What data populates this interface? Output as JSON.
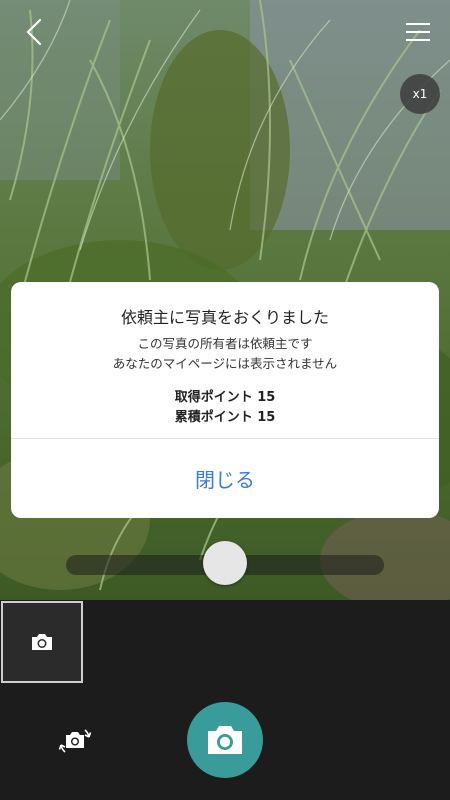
{
  "camera": {
    "zoom_label": "x1",
    "zoom_level": 0.0
  },
  "dialog": {
    "title": "依頼主に写真をおくりました",
    "message_line1": "この写真の所有者は依頼主です",
    "message_line2": "あなたのマイページには表示されません",
    "earned_points": "取得ポイント 15",
    "total_points": "累積ポイント 15",
    "close_label": "閉じる"
  },
  "icons": {
    "back": "chevron-left-icon",
    "menu": "hamburger-menu-icon",
    "gallery": "camera-icon",
    "switch": "switch-camera-icon",
    "shutter": "camera-icon"
  },
  "colors": {
    "accent": "#3a9c9a",
    "link": "#3a7bd5"
  }
}
